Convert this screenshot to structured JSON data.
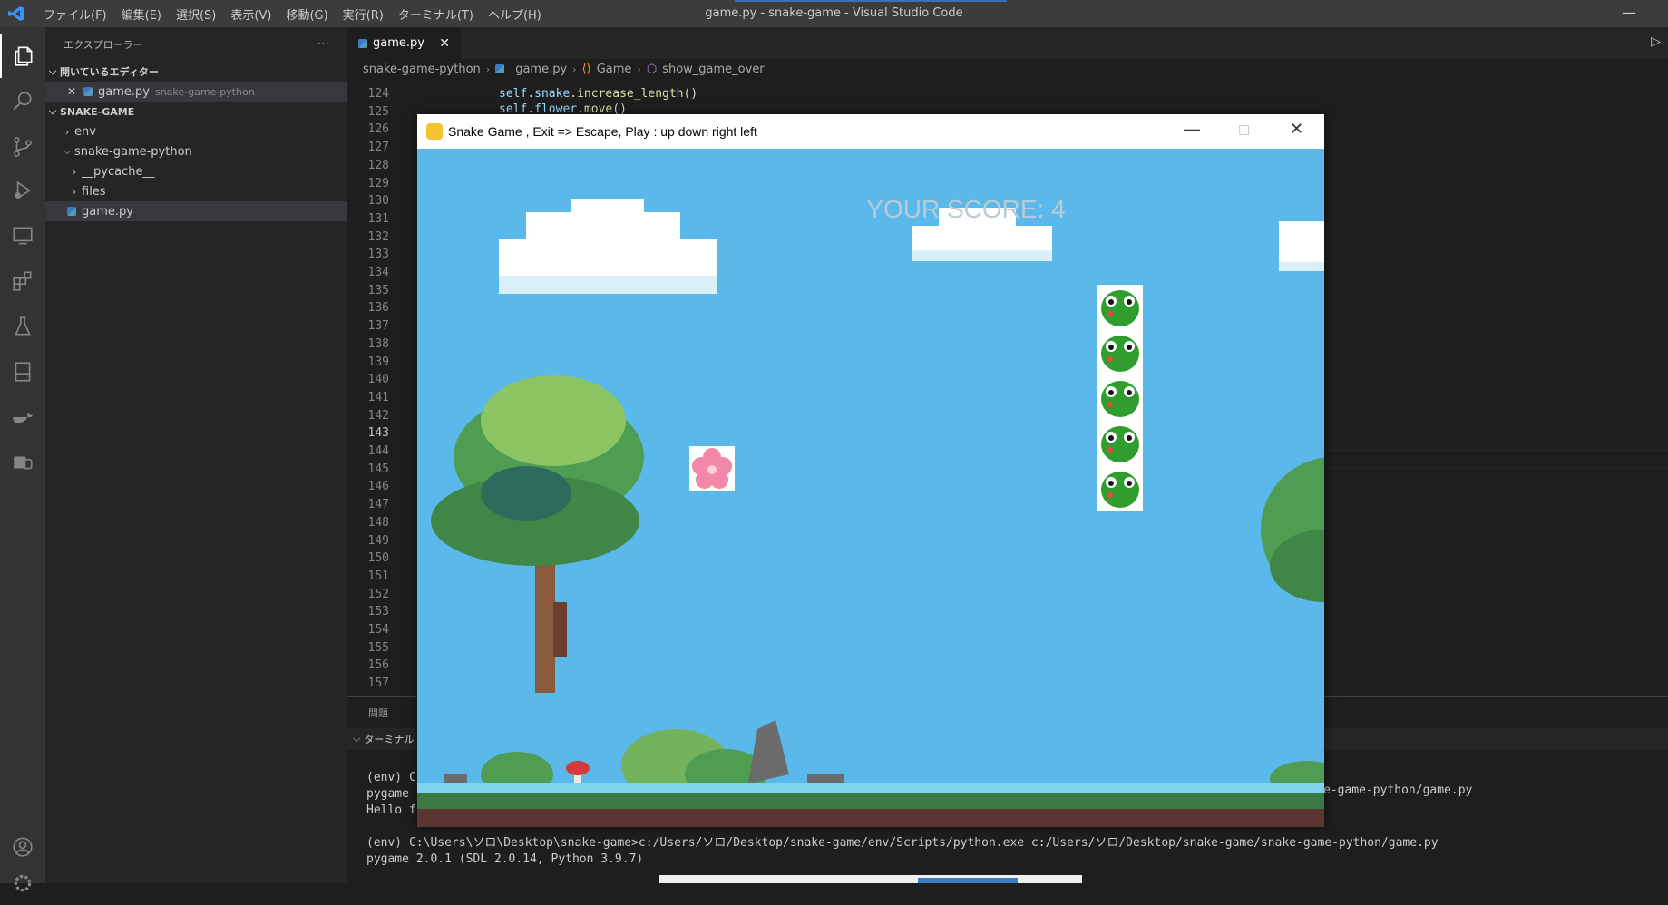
{
  "window": {
    "title": "game.py - snake-game - Visual Studio Code"
  },
  "menu": [
    "ファイル(F)",
    "編集(E)",
    "選択(S)",
    "表示(V)",
    "移動(G)",
    "実行(R)",
    "ターミナル(T)",
    "ヘルプ(H)"
  ],
  "sidebar": {
    "title": "エクスプローラー",
    "more": "···",
    "open_editors": "開いているエディター",
    "open_file": {
      "name": "game.py",
      "folder": "snake-game-python"
    },
    "project": "SNAKE-GAME",
    "items": [
      {
        "label": "env"
      },
      {
        "label": "snake-game-python"
      },
      {
        "label": "__pycache__"
      },
      {
        "label": "files"
      },
      {
        "label": "game.py"
      }
    ]
  },
  "tab": {
    "label": "game.py",
    "close": "✕"
  },
  "breadcrumbs": [
    "snake-game-python",
    "game.py",
    "Game",
    "show_game_over"
  ],
  "code": {
    "line_numbers": [
      "124",
      "125",
      "126",
      "127",
      "128",
      "129",
      "130",
      "131",
      "132",
      "133",
      "134",
      "135",
      "136",
      "137",
      "138",
      "139",
      "140",
      "141",
      "142",
      "143",
      "144",
      "145",
      "146",
      "147",
      "148",
      "149",
      "150",
      "151",
      "152",
      "153",
      "154",
      "155",
      "156",
      "157"
    ],
    "current_line": "143",
    "lines": [
      {
        "self": "self",
        "dot": ".",
        "obj": "snake",
        "dot2": ".",
        "fn": "increase_length",
        "paren": "()"
      },
      {
        "self": "self",
        "dot": ".",
        "obj": "flower",
        "dot2": ".",
        "fn": "move",
        "paren": "()"
      }
    ]
  },
  "panel": {
    "tab_problems": "問題",
    "terminal_header": "ターミナル",
    "lines": [
      "(env) C",
      "pygame ",
      "Hello f",
      "",
      "(env) C:\\Users\\ソロ\\Desktop\\snake-game>c:/Users/ソロ/Desktop/snake-game/env/Scripts/python.exe c:/Users/ソロ/Desktop/snake-game/snake-game-python/game.py",
      "pygame 2.0.1 (SDL 2.0.14, Python 3.9.7)"
    ],
    "right_tail": "e-game-python/game.py"
  },
  "game": {
    "title": "Snake Game  , Exit => Escape, Play : up down right left",
    "score": "YOUR SCORE: 4",
    "snake_length": 5
  },
  "colors": {
    "sky": "#5bb8ea",
    "accent": "#3794ff",
    "activity_bar": "#333333",
    "sidebar": "#252526",
    "editor": "#1e1e1e"
  }
}
